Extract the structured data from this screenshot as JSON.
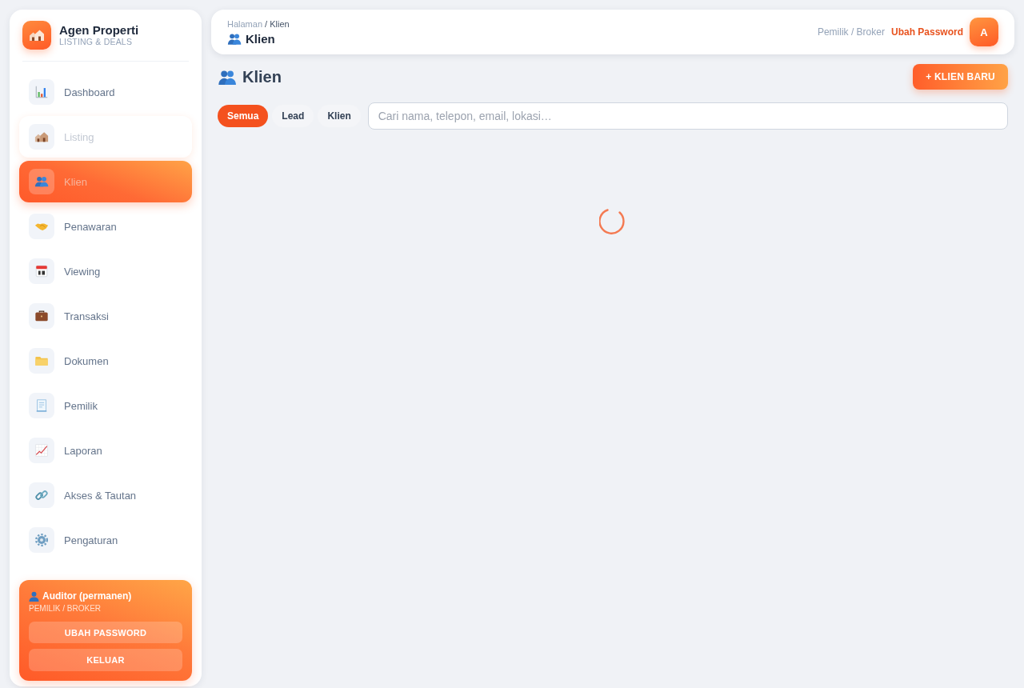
{
  "sidebar": {
    "brand": {
      "title": "Agen Properti",
      "subtitle": "LISTING & DEALS"
    },
    "items": [
      {
        "label": "Dashboard",
        "selected": false,
        "hovered": false
      },
      {
        "label": "Listing",
        "selected": false,
        "hovered": true
      },
      {
        "label": "Klien",
        "selected": true,
        "hovered": false
      },
      {
        "label": "Penawaran",
        "selected": false,
        "hovered": false
      },
      {
        "label": "Viewing",
        "selected": false,
        "hovered": false
      },
      {
        "label": "Transaksi",
        "selected": false,
        "hovered": false
      },
      {
        "label": "Dokumen",
        "selected": false,
        "hovered": false
      },
      {
        "label": "Pemilik",
        "selected": false,
        "hovered": false
      },
      {
        "label": "Laporan",
        "selected": false,
        "hovered": false
      },
      {
        "label": "Akses & Tautan",
        "selected": false,
        "hovered": false
      },
      {
        "label": "Pengaturan",
        "selected": false,
        "hovered": false
      }
    ],
    "user_card": {
      "name": "Auditor (permanen)",
      "role": "PEMILIK / BROKER",
      "buttons": [
        "UBAH PASSWORD",
        "KELUAR"
      ]
    }
  },
  "topbar": {
    "breadcrumb": {
      "parent": "Halaman",
      "separator": "/",
      "current": "Klien"
    },
    "title": "Klien",
    "role": "Pemilik / Broker",
    "link": "Ubah Password",
    "avatar": "A"
  },
  "page": {
    "title": "Klien",
    "new_button": "+ KLIEN BARU",
    "filters": [
      {
        "label": "Semua",
        "selected": true
      },
      {
        "label": "Lead",
        "selected": false
      },
      {
        "label": "Klien",
        "selected": false
      }
    ],
    "search": {
      "placeholder": "Cari nama, telepon, email, lokasi…"
    },
    "loading": true
  }
}
